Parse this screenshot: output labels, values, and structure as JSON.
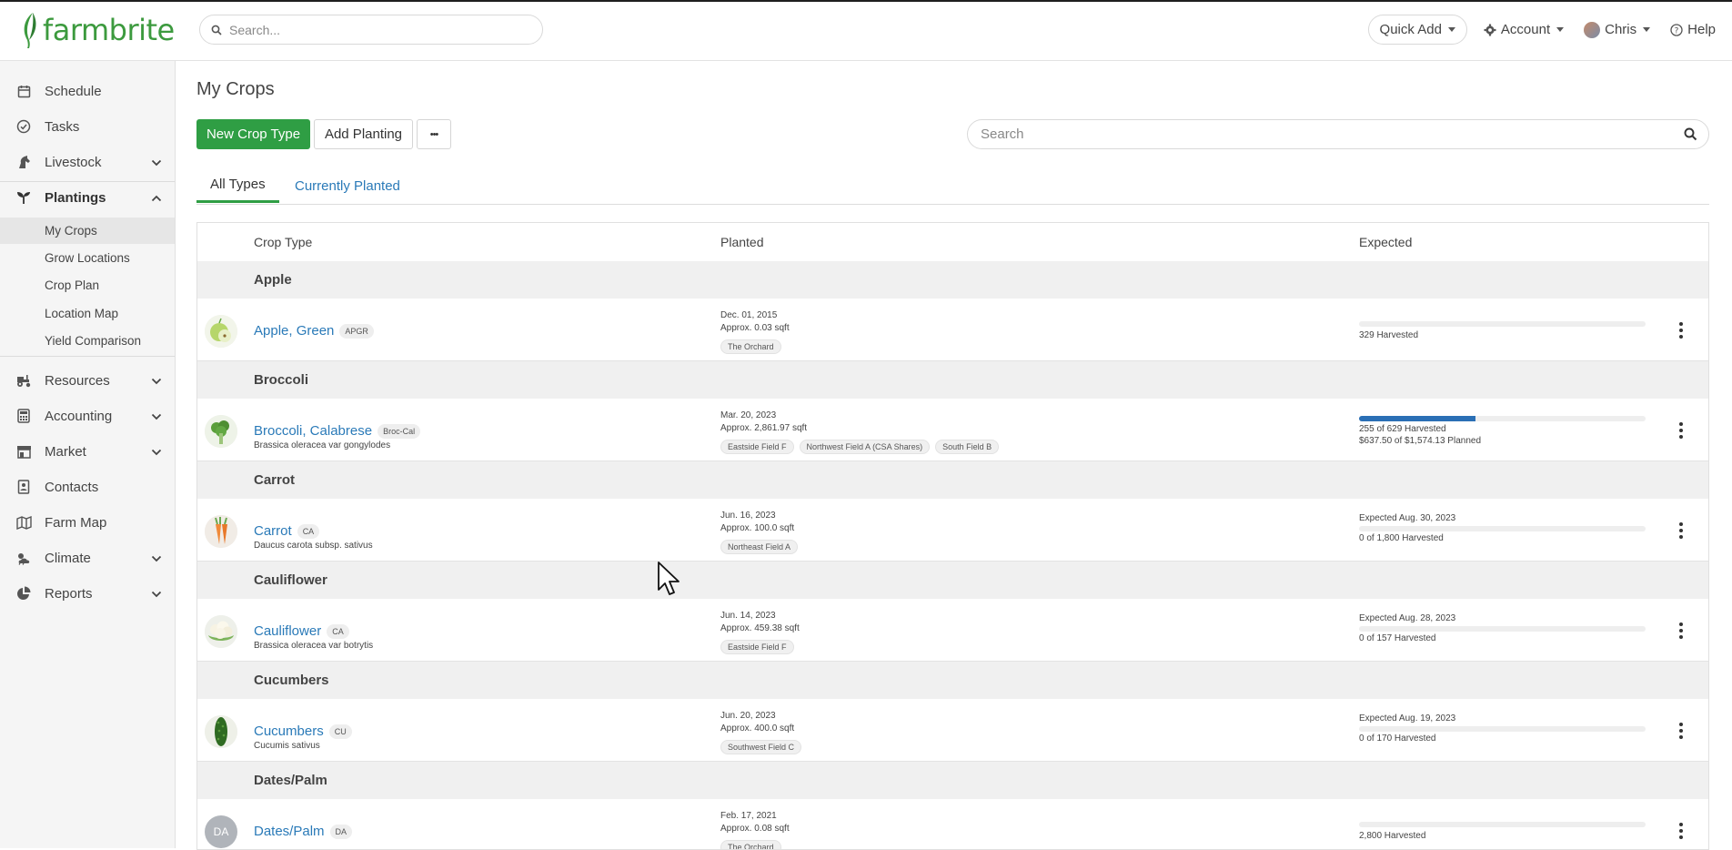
{
  "brand": {
    "name": "farmbrite",
    "green": "#3c9a3e"
  },
  "header": {
    "search_placeholder": "Search...",
    "quick_add": "Quick Add",
    "account": "Account",
    "user": "Chris",
    "help": "Help"
  },
  "sidebar": {
    "items": [
      {
        "label": "Schedule",
        "icon": "calendar-icon"
      },
      {
        "label": "Tasks",
        "icon": "check-circle-icon"
      },
      {
        "label": "Livestock",
        "icon": "horse-icon"
      },
      {
        "label": "Plantings",
        "icon": "seedling-icon"
      },
      {
        "label": "Resources",
        "icon": "tractor-icon"
      },
      {
        "label": "Accounting",
        "icon": "calculator-icon"
      },
      {
        "label": "Market",
        "icon": "store-icon"
      },
      {
        "label": "Contacts",
        "icon": "contacts-icon"
      },
      {
        "label": "Farm Map",
        "icon": "map-icon"
      },
      {
        "label": "Climate",
        "icon": "cloud-sun-icon"
      },
      {
        "label": "Reports",
        "icon": "pie-chart-icon"
      }
    ],
    "plantings_sub": [
      "My Crops",
      "Grow Locations",
      "Crop Plan",
      "Location Map",
      "Yield Comparison"
    ]
  },
  "page": {
    "title": "My Crops",
    "new_crop_type": "New Crop Type",
    "add_planting": "Add Planting",
    "more": "•••",
    "search_placeholder": "Search",
    "tabs": [
      "All Types",
      "Currently Planted"
    ]
  },
  "table": {
    "headers": {
      "crop_type": "Crop Type",
      "planted": "Planted",
      "expected": "Expected"
    },
    "groups": [
      {
        "name": "Apple",
        "crop": "Apple, Green",
        "code": "APGR",
        "scientific": "",
        "date": "Dec. 01, 2015",
        "area": "Approx. 0.03 sqft",
        "locations": [
          "The Orchard"
        ],
        "expected_date": "",
        "progress": 0,
        "harvest": "329 Harvested",
        "planned": ""
      },
      {
        "name": "Broccoli",
        "crop": "Broccoli, Calabrese",
        "code": "Broc-Cal",
        "scientific": "Brassica oleracea var gongylodes",
        "date": "Mar. 20, 2023",
        "area": "Approx. 2,861.97 sqft",
        "locations": [
          "Eastside Field F",
          "Northwest Field A (CSA Shares)",
          "South Field B"
        ],
        "expected_date": "",
        "progress": 0.405,
        "harvest": "255 of 629 Harvested",
        "planned": "$637.50 of $1,574.13 Planned"
      },
      {
        "name": "Carrot",
        "crop": "Carrot",
        "code": "CA",
        "scientific": "Daucus carota subsp. sativus",
        "date": "Jun. 16, 2023",
        "area": "Approx. 100.0 sqft",
        "locations": [
          "Northeast Field A"
        ],
        "expected_date": "Expected Aug. 30, 2023",
        "progress": 0,
        "harvest": "0 of 1,800 Harvested",
        "planned": ""
      },
      {
        "name": "Cauliflower",
        "crop": "Cauliflower",
        "code": "CA",
        "scientific": "Brassica oleracea var botrytis",
        "date": "Jun. 14, 2023",
        "area": "Approx. 459.38 sqft",
        "locations": [
          "Eastside Field F"
        ],
        "expected_date": "Expected Aug. 28, 2023",
        "progress": 0,
        "harvest": "0 of 157 Harvested",
        "planned": ""
      },
      {
        "name": "Cucumbers",
        "crop": "Cucumbers",
        "code": "CU",
        "scientific": "Cucumis sativus",
        "date": "Jun. 20, 2023",
        "area": "Approx. 400.0 sqft",
        "locations": [
          "Southwest Field C"
        ],
        "expected_date": "Expected Aug. 19, 2023",
        "progress": 0,
        "harvest": "0 of 170 Harvested",
        "planned": ""
      },
      {
        "name": "Dates/Palm",
        "crop": "Dates/Palm",
        "code": "DA",
        "scientific": "",
        "avatar_text": "DA",
        "date": "Feb. 17, 2021",
        "area": "Approx. 0.08 sqft",
        "locations": [
          "The Orchard"
        ],
        "expected_date": "",
        "progress": 0,
        "harvest": "2,800 Harvested",
        "planned": ""
      }
    ]
  }
}
